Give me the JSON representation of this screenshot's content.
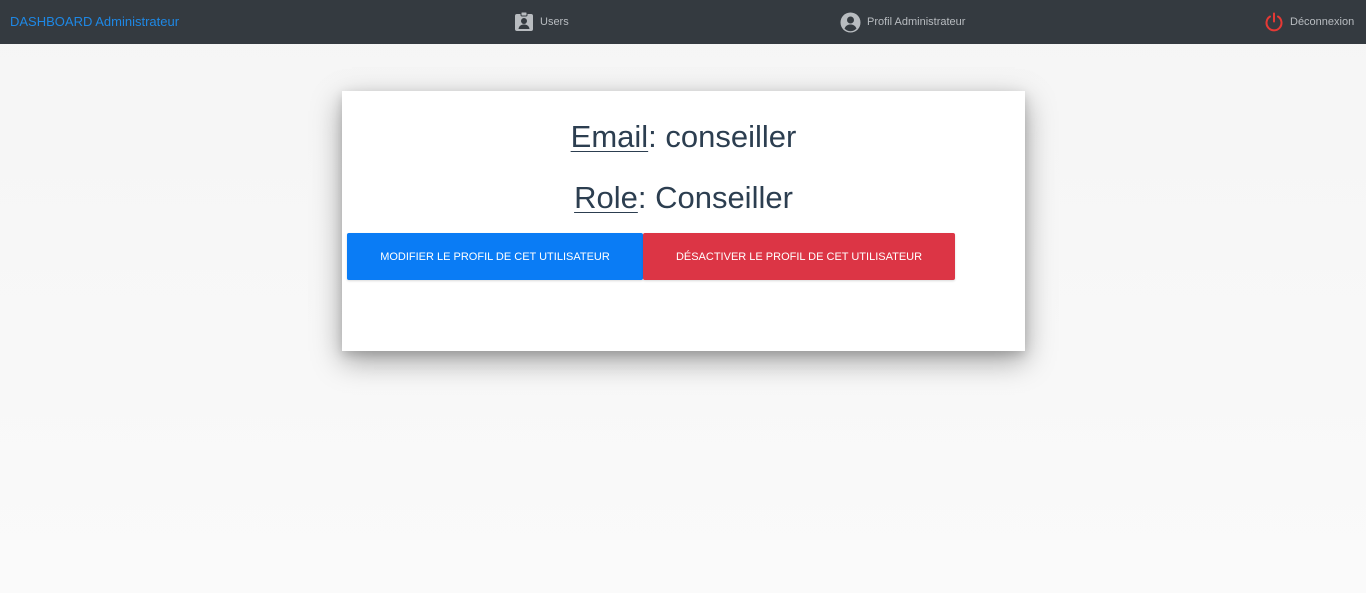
{
  "navbar": {
    "brand": "DASHBOARD Administrateur",
    "users_label": "Users",
    "users_icon": "user-badge-icon",
    "profile_label": "Profil Administrateur",
    "profile_icon": "account-circle-icon",
    "logout_label": "Déconnexion",
    "logout_icon": "power-icon",
    "background_color": "#343a40",
    "brand_color": "#1e88e5",
    "logout_icon_color": "#e53935"
  },
  "user_card": {
    "email_key": "Email",
    "email_value": ": conseiller",
    "role_key": "Role",
    "role_value": ": Conseiller",
    "edit_button_label": "MODIFIER LE PROFIL DE CET UTILISATEUR",
    "deactivate_button_label": "DÉSACTIVER LE PROFIL DE CET UTILISATEUR",
    "edit_button_color": "#0a7cf5",
    "deactivate_button_color": "#dc3545"
  }
}
